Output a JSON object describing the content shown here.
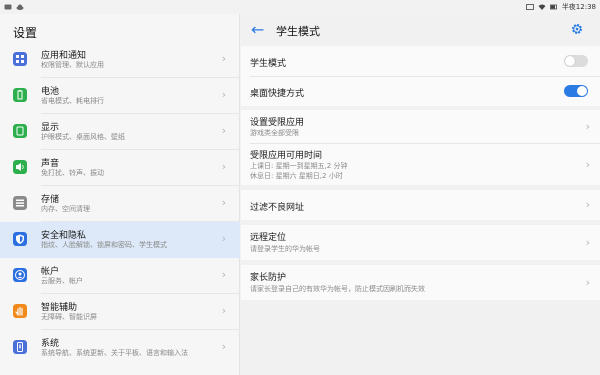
{
  "statusbar": {
    "time": "半夜12:38",
    "battery": "battery-icon",
    "wifi": "wifi-icon"
  },
  "left": {
    "title": "设置",
    "items": [
      {
        "label": "应用和通知",
        "sub": "权限管理、默认应用",
        "icon": "apps-icon",
        "color": "#4a6fd8"
      },
      {
        "label": "电池",
        "sub": "省电模式、耗电排行",
        "icon": "battery-icon",
        "color": "#2eaf4d"
      },
      {
        "label": "显示",
        "sub": "护眼模式、桌面风格、壁纸",
        "icon": "display-icon",
        "color": "#2eaf4d"
      },
      {
        "label": "声音",
        "sub": "免打扰、铃声、振动",
        "icon": "sound-icon",
        "color": "#2eaf4d"
      },
      {
        "label": "存储",
        "sub": "内存、空间清理",
        "icon": "storage-icon",
        "color": "#8a8a8a"
      },
      {
        "label": "安全和隐私",
        "sub": "指纹、人脸解锁、锁屏和密码、学生模式",
        "icon": "shield-icon",
        "color": "#2b6fe0"
      },
      {
        "label": "帐户",
        "sub": "云服务、帐户",
        "icon": "account-icon",
        "color": "#2b6fe0"
      },
      {
        "label": "智能辅助",
        "sub": "无障碍、智能识屏",
        "icon": "hand-icon",
        "color": "#f08a1c"
      },
      {
        "label": "系统",
        "sub": "系统导航、系统更新、关于平板、语言和输入法",
        "icon": "system-icon",
        "color": "#4a6fd8"
      }
    ]
  },
  "right": {
    "title": "学生模式",
    "toggles": [
      {
        "label": "学生模式",
        "state": "off"
      },
      {
        "label": "桌面快捷方式",
        "state": "on"
      }
    ],
    "restricted_apps": {
      "label": "设置受限应用",
      "sub": "游戏类全部受限"
    },
    "available_time": {
      "label": "受限应用可用时间",
      "sub1": "上课日: 星期一到星期五,2 分钟",
      "sub2": "休息日: 星期六 星期日,2 小时"
    },
    "url_filter": {
      "label": "过滤不良网址"
    },
    "location": {
      "label": "远程定位",
      "sub": "请登录学生的华为帐号"
    },
    "parent": {
      "label": "家长防护",
      "sub": "请家长登录自己的有效华为帐号，防止模式因刷机而失效"
    },
    "accent": "#2b7be4"
  }
}
